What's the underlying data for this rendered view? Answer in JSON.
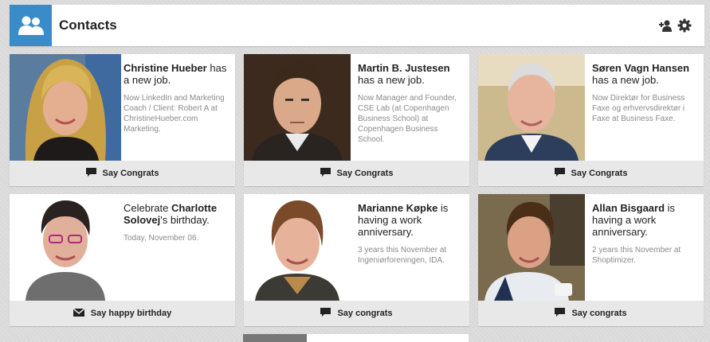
{
  "header": {
    "title": "Contacts",
    "icons": [
      "contacts-icon",
      "add-connection-icon",
      "gear-icon"
    ],
    "accent": "#3a8bc9"
  },
  "cards": [
    {
      "name_prefix": "",
      "name": "Christine Hueber",
      "name_suffix": " has a new job.",
      "detail": "Now LinkedIn and Marketing Coach / Client: Robert A at ChristineHueber.com Marketing.",
      "action": "Say Congrats",
      "action_icon": "speech-bubble-icon"
    },
    {
      "name_prefix": "",
      "name": "Martin B. Justesen",
      "name_suffix": " has a new job.",
      "detail": "Now Manager and Founder, CSE Lab (at Copenhagen Business School) at Copenhagen Business School.",
      "action": "Say Congrats",
      "action_icon": "speech-bubble-icon"
    },
    {
      "name_prefix": "",
      "name": "Søren Vagn Hansen",
      "name_suffix": " has a new job.",
      "detail": "Now Direktør for Business Faxe og erhvervsdirektør i Faxe at Business Faxe.",
      "action": "Say Congrats",
      "action_icon": "speech-bubble-icon"
    },
    {
      "name_prefix": "Celebrate ",
      "name": "Charlotte Solovej",
      "name_suffix": "'s birthday.",
      "detail": "Today, November 06.",
      "action": "Say happy birthday",
      "action_icon": "envelope-icon"
    },
    {
      "name_prefix": "",
      "name": "Marianne Køpke",
      "name_suffix": " is having a work anniversary.",
      "detail": "3 years this November at Ingeniørforeningen, IDA.",
      "action": "Say congrats",
      "action_icon": "speech-bubble-icon"
    },
    {
      "name_prefix": "",
      "name": "Allan Bisgaard",
      "name_suffix": " is having a work anniversary.",
      "detail": "2 years this November at Shoptimizer.",
      "action": "Say congrats",
      "action_icon": "speech-bubble-icon"
    }
  ]
}
